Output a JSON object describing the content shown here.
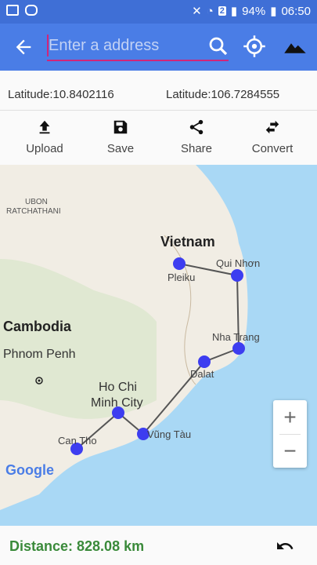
{
  "status_bar": {
    "battery_percent": "94%",
    "time": "06:50",
    "sim_badge": "2"
  },
  "toolbar": {
    "search_placeholder": "Enter a address",
    "icons": [
      "back-arrow-icon",
      "search-icon",
      "my-location-icon",
      "terrain-icon"
    ]
  },
  "coordinates": {
    "latitude_label": "Latitude:10.8402116",
    "longitude_label": "Latitude:106.7284555"
  },
  "actions": [
    {
      "label": "Upload",
      "icon": "upload-icon"
    },
    {
      "label": "Save",
      "icon": "save-icon"
    },
    {
      "label": "Share",
      "icon": "share-icon"
    },
    {
      "label": "Convert",
      "icon": "swap-icon"
    }
  ],
  "map": {
    "labels": {
      "ubon": "UBON",
      "ratchathani": "RATCHATHANI",
      "vietnam": "Vietnam",
      "pleiku": "Pleiku",
      "quinhon": "Qui Nhơn",
      "cambodia": "Cambodia",
      "phnompenh": "Phnom Penh",
      "nhatrang": "Nha Trang",
      "dalat": "Dalat",
      "hochi": "Ho Chi",
      "minhcity": "Minh City",
      "vungtau": "Vũng Tàu",
      "cantho": "Can Tho",
      "google": "Google"
    },
    "colors": {
      "marker": "#3d3df0",
      "route": "#555555",
      "sea": "#a9d8f5",
      "land": "#f1ede4",
      "forest": "#cfe3bf"
    },
    "zoom_in_label": "+",
    "zoom_out_label": "−"
  },
  "footer": {
    "distance_text": "Distance: 828.08 km",
    "undo_icon": "undo-icon"
  }
}
